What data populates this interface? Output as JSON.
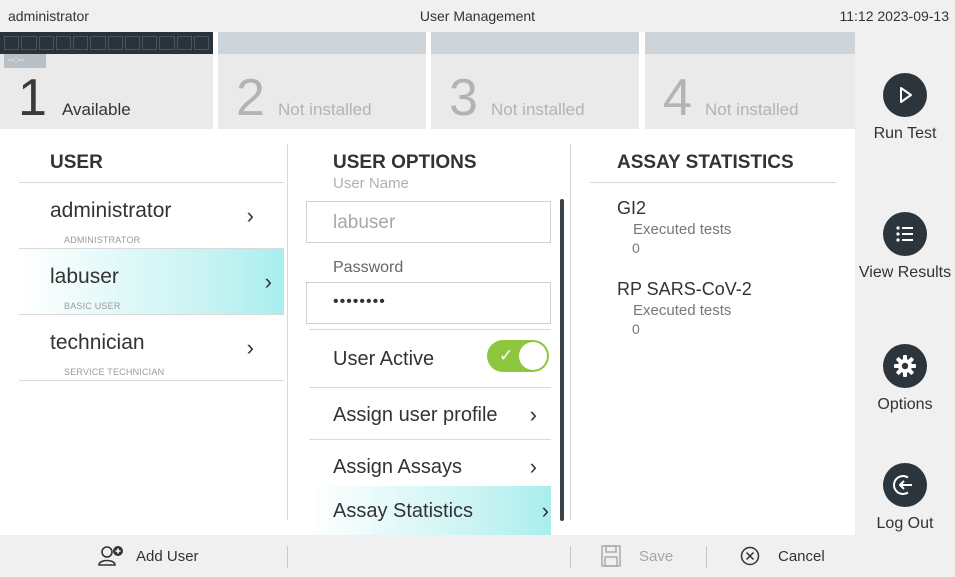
{
  "topbar": {
    "user": "administrator",
    "title": "User Management",
    "datetime": "11:12 2023-09-13"
  },
  "modules": [
    {
      "number": "1",
      "status": "Available",
      "tag": "--:--"
    },
    {
      "number": "2",
      "status": "Not installed"
    },
    {
      "number": "3",
      "status": "Not installed"
    },
    {
      "number": "4",
      "status": "Not installed"
    }
  ],
  "sidebar": {
    "run_test": "Run Test",
    "view_results": "View Results",
    "options": "Options",
    "log_out": "Log Out"
  },
  "user_column": {
    "header": "USER",
    "users": [
      {
        "name": "administrator",
        "role": "ADMINISTRATOR"
      },
      {
        "name": "labuser",
        "role": "BASIC USER"
      },
      {
        "name": "technician",
        "role": "SERVICE TECHNICIAN"
      }
    ]
  },
  "options_column": {
    "header": "USER OPTIONS",
    "username_label": "User Name",
    "username_value": "labuser",
    "password_label": "Password",
    "password_value": "••••••••",
    "user_active_label": "User Active",
    "user_active": true,
    "assign_profile": "Assign user profile",
    "assign_assays": "Assign Assays",
    "assay_statistics": "Assay Statistics"
  },
  "stats_column": {
    "header": "ASSAY STATISTICS",
    "assays": [
      {
        "name": "GI2",
        "label": "Executed tests",
        "count": "0"
      },
      {
        "name": "RP SARS-CoV-2",
        "label": "Executed tests",
        "count": "0"
      }
    ]
  },
  "bottombar": {
    "add_user": "Add User",
    "save": "Save",
    "cancel": "Cancel"
  },
  "colors": {
    "accent_green": "#8dc63f",
    "selection_cyan": "#a9eeee",
    "dark_icon": "#2d353c"
  }
}
